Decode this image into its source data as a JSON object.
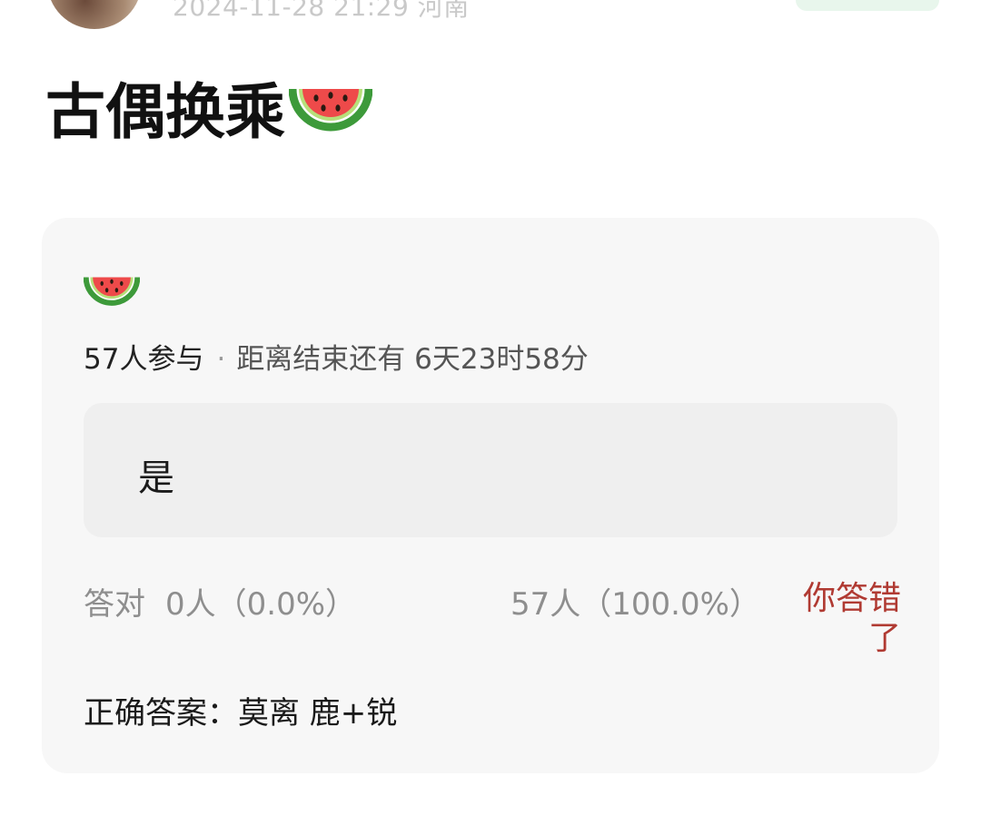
{
  "header": {
    "meta": "2024-11-28 21:29  河南"
  },
  "post": {
    "title": "古偶换乘",
    "title_emoji": "watermelon-icon"
  },
  "poll": {
    "emoji": "watermelon-icon",
    "participants": "57人参与",
    "separator": "·",
    "time_remaining": "距离结束还有 6天23时58分",
    "option_label": "是",
    "correct_label": "答对",
    "correct_count": "0人（0.0%）",
    "option_result": "57人（100.0%）",
    "wrong_notice": "你答错了",
    "answer": "正确答案：莫离 鹿+锐"
  },
  "colors": {
    "card_bg": "#f7f7f7",
    "option_bg": "#efefef",
    "wrong_red": "#b03a32",
    "muted_text": "#8e8e8e",
    "follow_green": "#e8f6ec"
  }
}
